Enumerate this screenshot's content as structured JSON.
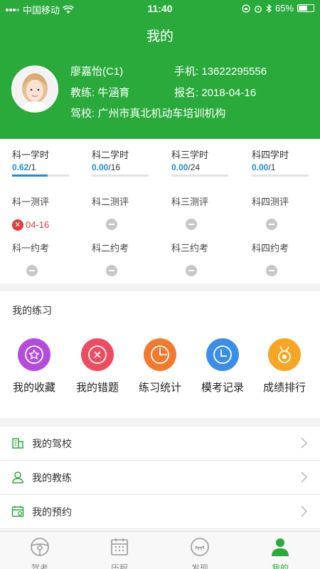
{
  "status_bar": {
    "carrier": "中国移动",
    "time": "11:40",
    "battery": "65%",
    "battery_level": 0.65
  },
  "header": {
    "title": "我的",
    "name": "廖嘉怡(C1)",
    "phone": "手机: 13622295556",
    "coach": "教练: 牛涵育",
    "signup": "报名: 2018-04-16",
    "school": "驾校: 广州市真北机动车培训机构"
  },
  "progress": [
    {
      "label": "科一学时",
      "current": "0.62",
      "total": "/1",
      "fraction": 0.62
    },
    {
      "label": "科二学时",
      "current": "0.00",
      "total": "/16",
      "fraction": 0
    },
    {
      "label": "科三学时",
      "current": "0.00",
      "total": "/24",
      "fraction": 0
    },
    {
      "label": "科四学时",
      "current": "0.00",
      "total": "/1",
      "fraction": 0
    }
  ],
  "evaluations": [
    {
      "label": "科一测评",
      "status": "failed",
      "date": "04-16"
    },
    {
      "label": "科二测评",
      "status": "none"
    },
    {
      "label": "科三测评",
      "status": "none"
    },
    {
      "label": "科四测评",
      "status": "none"
    }
  ],
  "exams": [
    {
      "label": "科一约考"
    },
    {
      "label": "科二约考"
    },
    {
      "label": "科三约考"
    },
    {
      "label": "科四约考"
    }
  ],
  "practice": {
    "title": "我的练习",
    "items": [
      {
        "label": "我的收藏",
        "icon": "star-icon",
        "color": "#b44bdc"
      },
      {
        "label": "我的错题",
        "icon": "close-circle-icon",
        "color": "#ef4b5e"
      },
      {
        "label": "练习统计",
        "icon": "pie-chart-icon",
        "color": "#f27a2e"
      },
      {
        "label": "模考记录",
        "icon": "clock-icon",
        "color": "#3b8ee8"
      },
      {
        "label": "成绩排行",
        "icon": "medal-icon",
        "color": "#f6a623"
      }
    ]
  },
  "menu": [
    {
      "label": "我的驾校",
      "icon": "building-icon"
    },
    {
      "label": "我的教练",
      "icon": "coach-icon"
    },
    {
      "label": "我的预约",
      "icon": "calendar-icon"
    }
  ],
  "tabs": [
    {
      "label": "驾考",
      "icon": "steering-wheel-icon",
      "active": false
    },
    {
      "label": "历程",
      "icon": "calendar-grid-icon",
      "active": false
    },
    {
      "label": "发现",
      "icon": "discover-icon",
      "active": false
    },
    {
      "label": "我的",
      "icon": "person-icon",
      "active": true
    }
  ],
  "colors": {
    "brand": "#2aaa3b",
    "progress": "#1a8ed8",
    "error": "#e23b3b"
  }
}
